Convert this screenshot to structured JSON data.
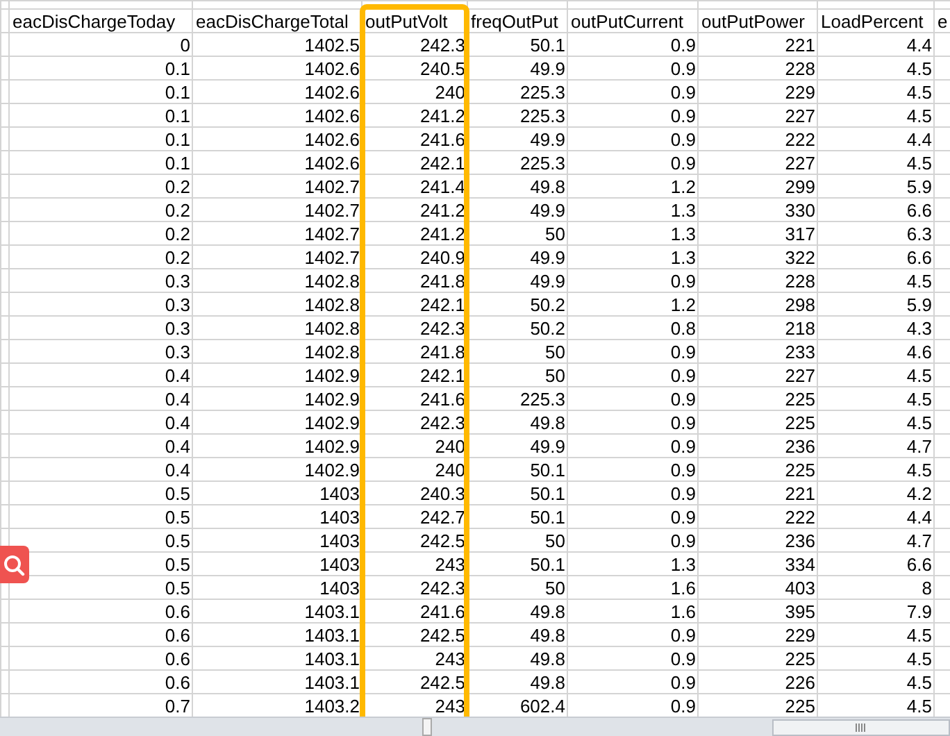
{
  "table": {
    "columns": [
      {
        "label": "eacDisChargeToday",
        "highlighted": false
      },
      {
        "label": "eacDisChargeTotal",
        "highlighted": false
      },
      {
        "label": "outPutVolt",
        "highlighted": true
      },
      {
        "label": "freqOutPut",
        "highlighted": false
      },
      {
        "label": "outPutCurrent",
        "highlighted": false
      },
      {
        "label": "outPutPower",
        "highlighted": false
      },
      {
        "label": "LoadPercent",
        "highlighted": false
      },
      {
        "label": "e",
        "highlighted": false
      }
    ],
    "rows": [
      [
        "0",
        "1402.5",
        "242.3",
        "50.1",
        "0.9",
        "221",
        "4.4"
      ],
      [
        "0.1",
        "1402.6",
        "240.5",
        "49.9",
        "0.9",
        "228",
        "4.5"
      ],
      [
        "0.1",
        "1402.6",
        "240",
        "225.3",
        "0.9",
        "229",
        "4.5"
      ],
      [
        "0.1",
        "1402.6",
        "241.2",
        "225.3",
        "0.9",
        "227",
        "4.5"
      ],
      [
        "0.1",
        "1402.6",
        "241.6",
        "49.9",
        "0.9",
        "222",
        "4.4"
      ],
      [
        "0.1",
        "1402.6",
        "242.1",
        "225.3",
        "0.9",
        "227",
        "4.5"
      ],
      [
        "0.2",
        "1402.7",
        "241.4",
        "49.8",
        "1.2",
        "299",
        "5.9"
      ],
      [
        "0.2",
        "1402.7",
        "241.2",
        "49.9",
        "1.3",
        "330",
        "6.6"
      ],
      [
        "0.2",
        "1402.7",
        "241.2",
        "50",
        "1.3",
        "317",
        "6.3"
      ],
      [
        "0.2",
        "1402.7",
        "240.9",
        "49.9",
        "1.3",
        "322",
        "6.6"
      ],
      [
        "0.3",
        "1402.8",
        "241.8",
        "49.9",
        "0.9",
        "228",
        "4.5"
      ],
      [
        "0.3",
        "1402.8",
        "242.1",
        "50.2",
        "1.2",
        "298",
        "5.9"
      ],
      [
        "0.3",
        "1402.8",
        "242.3",
        "50.2",
        "0.8",
        "218",
        "4.3"
      ],
      [
        "0.3",
        "1402.8",
        "241.8",
        "50",
        "0.9",
        "233",
        "4.6"
      ],
      [
        "0.4",
        "1402.9",
        "242.1",
        "50",
        "0.9",
        "227",
        "4.5"
      ],
      [
        "0.4",
        "1402.9",
        "241.6",
        "225.3",
        "0.9",
        "225",
        "4.5"
      ],
      [
        "0.4",
        "1402.9",
        "242.3",
        "49.8",
        "0.9",
        "225",
        "4.5"
      ],
      [
        "0.4",
        "1402.9",
        "240",
        "49.9",
        "0.9",
        "236",
        "4.7"
      ],
      [
        "0.4",
        "1402.9",
        "240",
        "50.1",
        "0.9",
        "225",
        "4.5"
      ],
      [
        "0.5",
        "1403",
        "240.3",
        "50.1",
        "0.9",
        "221",
        "4.2"
      ],
      [
        "0.5",
        "1403",
        "242.7",
        "50.1",
        "0.9",
        "222",
        "4.4"
      ],
      [
        "0.5",
        "1403",
        "242.5",
        "50",
        "0.9",
        "236",
        "4.7"
      ],
      [
        "0.5",
        "1403",
        "243",
        "50.1",
        "1.3",
        "334",
        "6.6"
      ],
      [
        "0.5",
        "1403",
        "242.3",
        "50",
        "1.6",
        "403",
        "8"
      ],
      [
        "0.6",
        "1403.1",
        "241.6",
        "49.8",
        "1.6",
        "395",
        "7.9"
      ],
      [
        "0.6",
        "1403.1",
        "242.5",
        "49.8",
        "0.9",
        "229",
        "4.5"
      ],
      [
        "0.6",
        "1403.1",
        "243",
        "49.8",
        "0.9",
        "225",
        "4.5"
      ],
      [
        "0.6",
        "1403.1",
        "242.5",
        "49.8",
        "0.9",
        "226",
        "4.5"
      ],
      [
        "0.7",
        "1403.2",
        "243",
        "602.4",
        "0.9",
        "225",
        "4.5"
      ]
    ]
  }
}
